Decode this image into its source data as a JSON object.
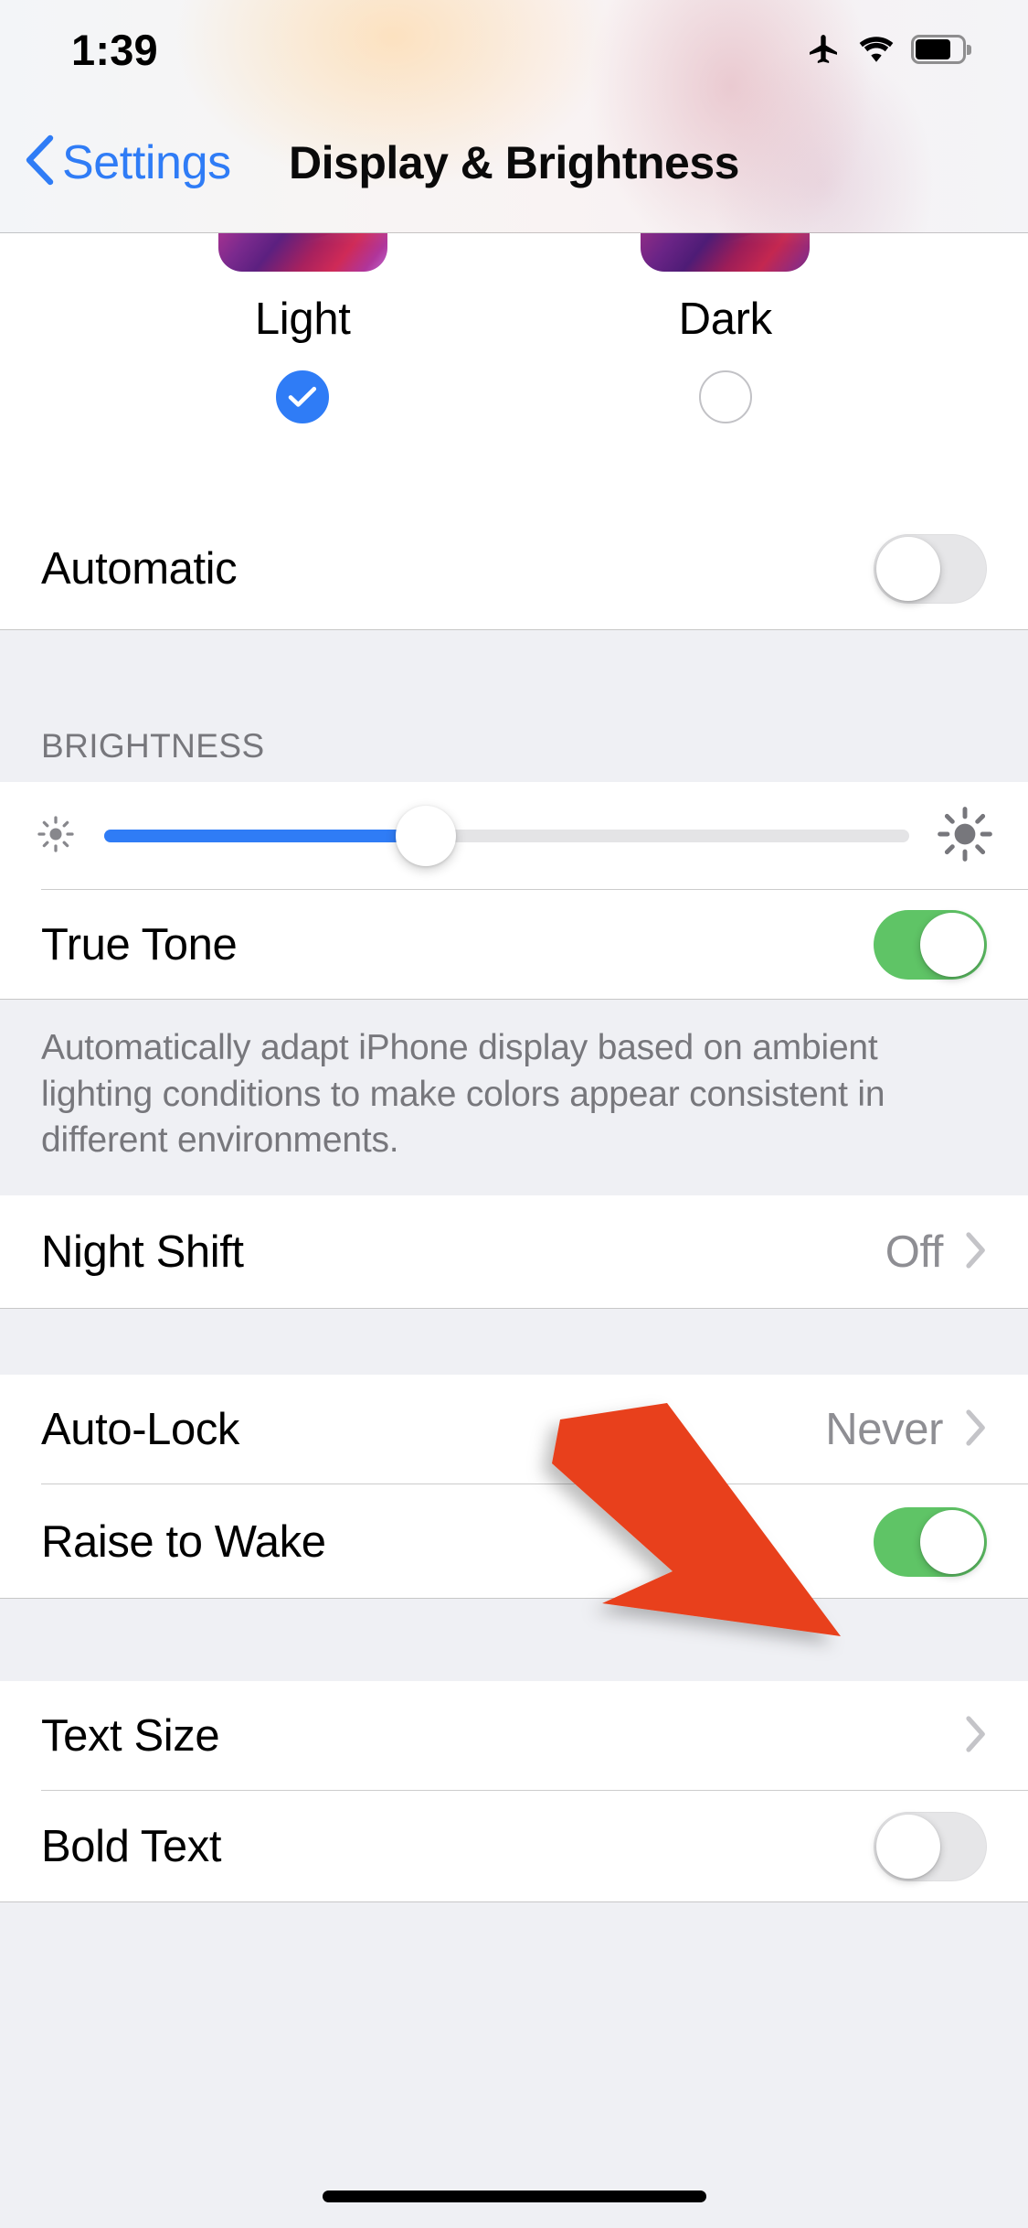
{
  "status_bar": {
    "time": "1:39",
    "icons": [
      "airplane-mode-icon",
      "wifi-icon",
      "battery-icon"
    ],
    "battery_level_percent": 75
  },
  "nav_bar": {
    "back_label": "Settings",
    "back_icon": "chevron-left-icon",
    "title": "Display & Brightness"
  },
  "appearance": {
    "options": [
      {
        "label": "Light",
        "selected": true
      },
      {
        "label": "Dark",
        "selected": false
      }
    ],
    "automatic": {
      "label": "Automatic",
      "toggle_on": false
    }
  },
  "brightness": {
    "header": "BRIGHTNESS",
    "slider": {
      "value_percent": 40,
      "min_icon": "sun-small-icon",
      "max_icon": "sun-large-icon"
    },
    "true_tone": {
      "label": "True Tone",
      "toggle_on": true
    },
    "footer": "Automatically adapt iPhone display based on ambient lighting conditions to make colors appear consistent in different environments."
  },
  "night_shift": {
    "label": "Night Shift",
    "value": "Off",
    "chevron": "chevron-right-icon"
  },
  "lock": {
    "auto_lock": {
      "label": "Auto-Lock",
      "value": "Never",
      "chevron": "chevron-right-icon"
    },
    "raise_to_wake": {
      "label": "Raise to Wake",
      "toggle_on": true
    }
  },
  "text": {
    "text_size": {
      "label": "Text Size",
      "chevron": "chevron-right-icon"
    },
    "bold_text": {
      "label": "Bold Text",
      "toggle_on": false
    }
  },
  "annotation": {
    "type": "arrow",
    "color": "#e8411f",
    "points_to": "raise-to-wake-toggle"
  },
  "colors": {
    "accent_blue": "#2f7cf6",
    "toggle_green": "#5fc466",
    "group_background": "#eff0f4",
    "row_background": "#ffffff",
    "secondary_text": "#8e8e93",
    "annotation_red": "#e8411f"
  }
}
